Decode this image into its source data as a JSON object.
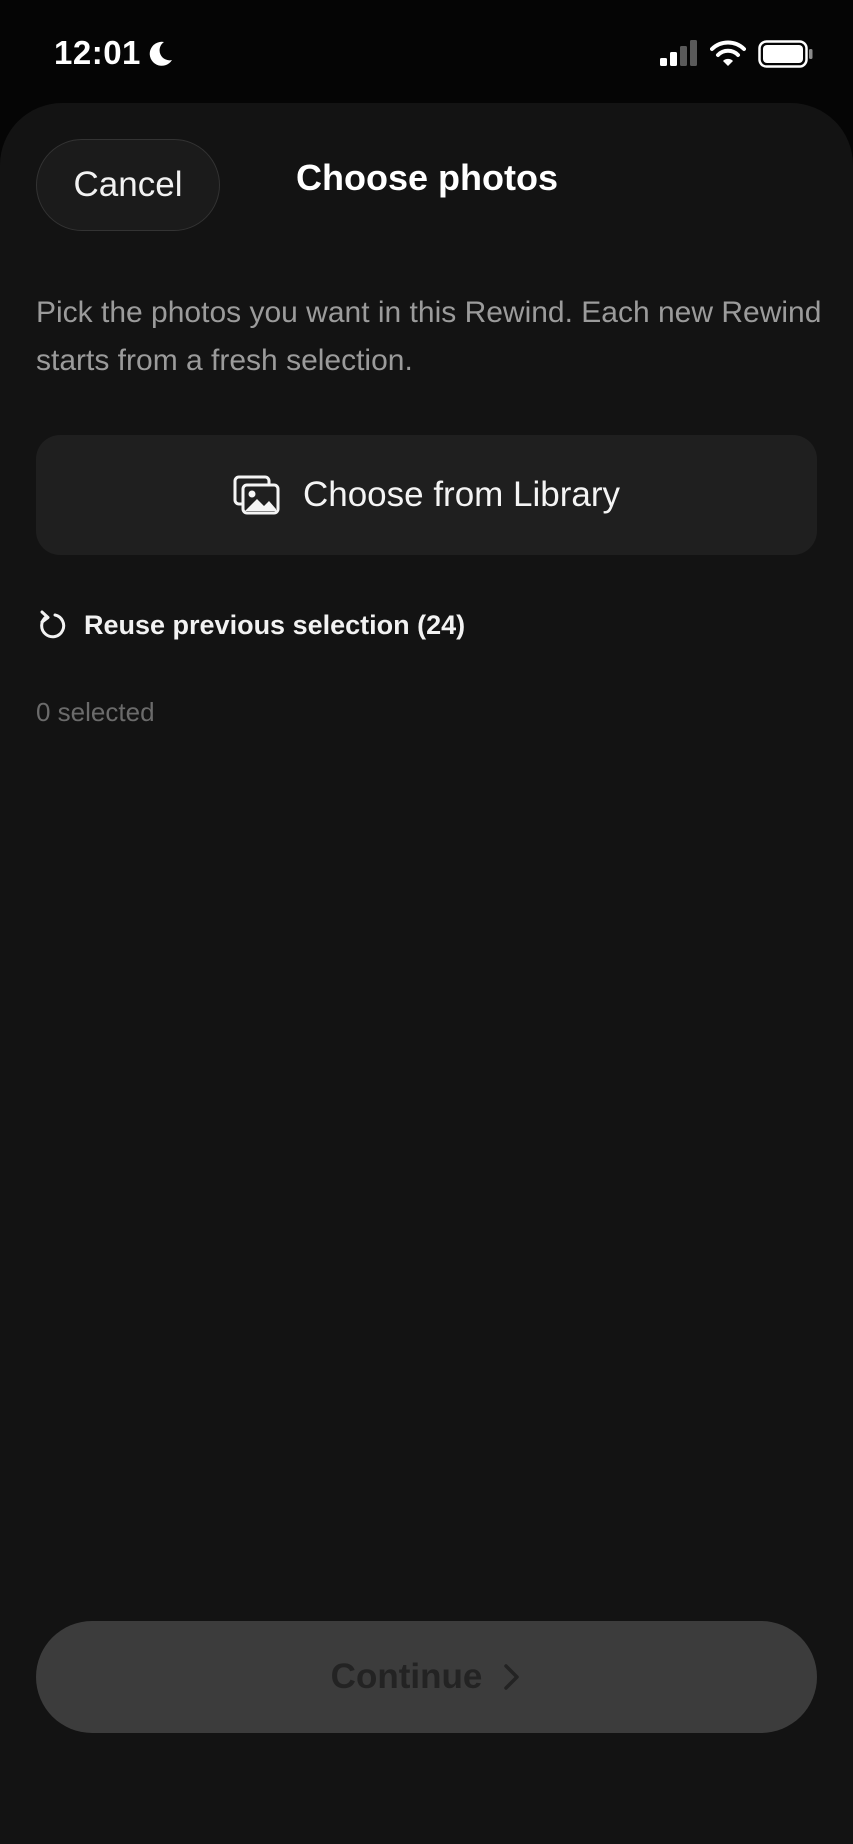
{
  "status_bar": {
    "time": "12:01",
    "icons": [
      "moon-icon",
      "signal-icon",
      "wifi-icon",
      "battery-icon"
    ]
  },
  "header": {
    "cancel_label": "Cancel",
    "title": "Choose photos"
  },
  "description": "Pick the photos you want in this Rewind. Each new Rewind starts from a fresh selection.",
  "library_button": {
    "label": "Choose from Library",
    "icon": "photos-icon"
  },
  "reuse": {
    "label": "Reuse previous selection (24)",
    "icon": "reuse-icon"
  },
  "selection": {
    "count_label": "0 selected"
  },
  "footer": {
    "continue_label": "Continue",
    "icon": "chevron-right-icon"
  },
  "colors": {
    "background": "#131313",
    "status_background": "#050505",
    "button_surface": "#1f1f1f",
    "continue_disabled": "#3c3c3c",
    "secondary_text": "#9b9b9b"
  }
}
